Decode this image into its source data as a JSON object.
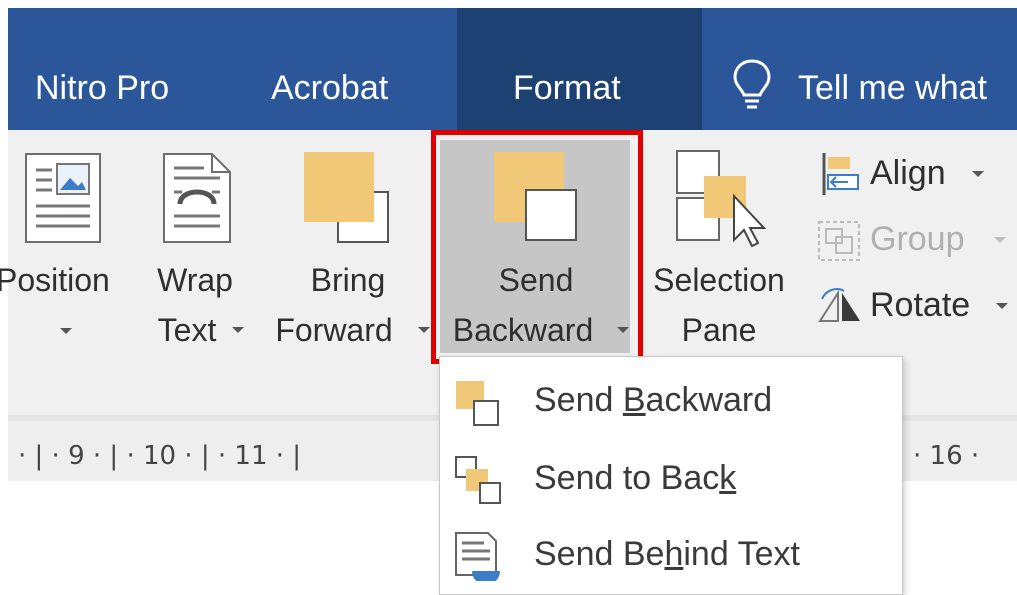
{
  "tabs": {
    "nitro": "Nitro Pro",
    "acrobat": "Acrobat",
    "format": "Format",
    "tell_me": "Tell me what"
  },
  "ribbon": {
    "position": {
      "label_line1": "Position",
      "caret": "▾"
    },
    "wrap_text": {
      "label_line1": "Wrap",
      "label_line2": "Text"
    },
    "bring_forward": {
      "label_line1": "Bring",
      "label_line2": "Forward"
    },
    "send_backward": {
      "label_line1": "Send",
      "label_line2": "Backward"
    },
    "selection_pane": {
      "label_line1": "Selection",
      "label_line2": "Pane"
    },
    "align": "Align",
    "group": "Group",
    "rotate": "Rotate"
  },
  "ruler": {
    "left_text": "· | · 9 · | · 10 · | · 11 · |",
    "right_text": "| · 16 ·"
  },
  "menu": {
    "items": [
      {
        "pre": "Send ",
        "key": "B",
        "post": "ackward",
        "icon": "send-backward-icon"
      },
      {
        "pre": "Send to Bac",
        "key": "k",
        "post": "",
        "icon": "send-to-back-icon"
      },
      {
        "pre": "Send Be",
        "key": "h",
        "post": "ind Text",
        "icon": "send-behind-text-icon"
      }
    ]
  },
  "colors": {
    "tab_bar": "#2b579a",
    "tab_active": "#1e4173",
    "ribbon_bg": "#f0f0f0",
    "highlight_border": "#e00000",
    "shape_orange": "#f0c878"
  }
}
